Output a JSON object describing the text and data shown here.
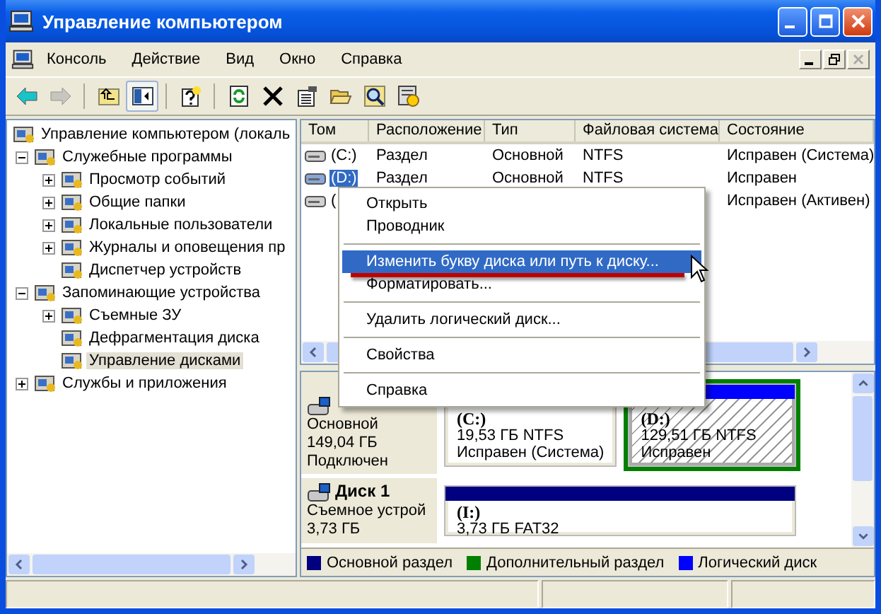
{
  "window": {
    "title": "Управление компьютером"
  },
  "menu_bar": {
    "items": [
      "Консоль",
      "Действие",
      "Вид",
      "Окно",
      "Справка"
    ]
  },
  "toolbar": [
    {
      "kind": "back",
      "disabled": false,
      "pressed": false
    },
    {
      "kind": "forward",
      "disabled": true,
      "pressed": false
    },
    {
      "kind": "separator"
    },
    {
      "kind": "up",
      "disabled": false,
      "pressed": false
    },
    {
      "kind": "tree-toggle",
      "disabled": false,
      "pressed": true
    },
    {
      "kind": "separator"
    },
    {
      "kind": "help",
      "disabled": false,
      "pressed": false
    },
    {
      "kind": "separator"
    },
    {
      "kind": "refresh",
      "disabled": false,
      "pressed": false
    },
    {
      "kind": "delete",
      "disabled": false,
      "pressed": false
    },
    {
      "kind": "properties",
      "disabled": false,
      "pressed": false
    },
    {
      "kind": "open",
      "disabled": false,
      "pressed": false
    },
    {
      "kind": "search",
      "disabled": false,
      "pressed": false
    },
    {
      "kind": "settings",
      "disabled": false,
      "pressed": false
    }
  ],
  "tree": {
    "items": [
      {
        "kind": "root",
        "label": "Управление компьютером (локаль",
        "selected": false,
        "children": [
          {
            "kind": "folder",
            "label": "Служебные программы",
            "expanded": true,
            "selected": false,
            "children": [
              {
                "kind": "folder",
                "label": "Просмотр событий",
                "expanded": false,
                "selected": false
              },
              {
                "kind": "folder",
                "label": "Общие папки",
                "expanded": false,
                "selected": false
              },
              {
                "kind": "folder",
                "label": "Локальные пользователи",
                "expanded": false,
                "selected": false
              },
              {
                "kind": "folder",
                "label": "Журналы и оповещения пр",
                "expanded": false,
                "selected": false
              },
              {
                "kind": "leaf",
                "label": "Диспетчер устройств",
                "selected": false
              }
            ]
          },
          {
            "kind": "folder",
            "label": "Запоминающие устройства",
            "expanded": true,
            "selected": false,
            "children": [
              {
                "kind": "folder",
                "label": "Съемные ЗУ",
                "expanded": false,
                "selected": false
              },
              {
                "kind": "leaf",
                "label": "Дефрагментация диска",
                "selected": false
              },
              {
                "kind": "leaf",
                "label": "Управление дисками",
                "selected": true
              }
            ]
          },
          {
            "kind": "folder",
            "label": "Службы и приложения",
            "expanded": false,
            "selected": false
          }
        ]
      }
    ]
  },
  "volumes": {
    "columns": [
      "Том",
      "Расположение",
      "Тип",
      "Файловая система",
      "Состояние"
    ],
    "rows": [
      {
        "volume": "(C:)",
        "layout": "Раздел",
        "type": "Основной",
        "file_system": "NTFS",
        "status": "Исправен (Система)",
        "selected": false
      },
      {
        "volume": "(D:)",
        "layout": "Раздел",
        "type": "Основной",
        "file_system": "NTFS",
        "status": "Исправен",
        "selected": true
      },
      {
        "volume": "(",
        "status": "Исправен (Активен)",
        "selected": false
      }
    ]
  },
  "disks": [
    {
      "type": "Основной",
      "size": "149,04 ГБ",
      "state": "Подключен",
      "partitions": [
        {
          "kind": "primary",
          "label": "(C:)",
          "size_fs": "19,53 ГБ NTFS",
          "status": "Исправен (Система)",
          "selected": false
        },
        {
          "kind": "logical",
          "label": "(D:)",
          "size_fs": "129,51 ГБ NTFS",
          "status": "Исправен",
          "selected": true
        }
      ]
    },
    {
      "name": "Диск 1",
      "type": "Съемное устрой",
      "size": "3,73 ГБ",
      "partitions": [
        {
          "kind": "primary",
          "label": "(I:)",
          "size_fs": "3,73 ГБ FAT32",
          "selected": false
        }
      ]
    }
  ],
  "legend": [
    {
      "kind": "primary",
      "label": "Основной раздел",
      "color": "#000080"
    },
    {
      "kind": "extended",
      "label": "Дополнительный раздел",
      "color": "#008000"
    },
    {
      "kind": "logical",
      "label": "Логический диск",
      "color": "#0000ff"
    }
  ],
  "context_menu": {
    "items": [
      {
        "kind": "item",
        "label": "Открыть",
        "selected": false
      },
      {
        "kind": "item",
        "label": "Проводник",
        "selected": false
      },
      {
        "kind": "separator"
      },
      {
        "kind": "item",
        "label": "Изменить букву диска или путь к диску...",
        "selected": true
      },
      {
        "kind": "item",
        "label": "Форматировать...",
        "selected": false
      },
      {
        "kind": "separator"
      },
      {
        "kind": "item",
        "label": "Удалить логический диск...",
        "selected": false
      },
      {
        "kind": "separator"
      },
      {
        "kind": "item",
        "label": "Свойства",
        "selected": false
      },
      {
        "kind": "separator"
      },
      {
        "kind": "item",
        "label": "Справка",
        "selected": false
      }
    ]
  }
}
